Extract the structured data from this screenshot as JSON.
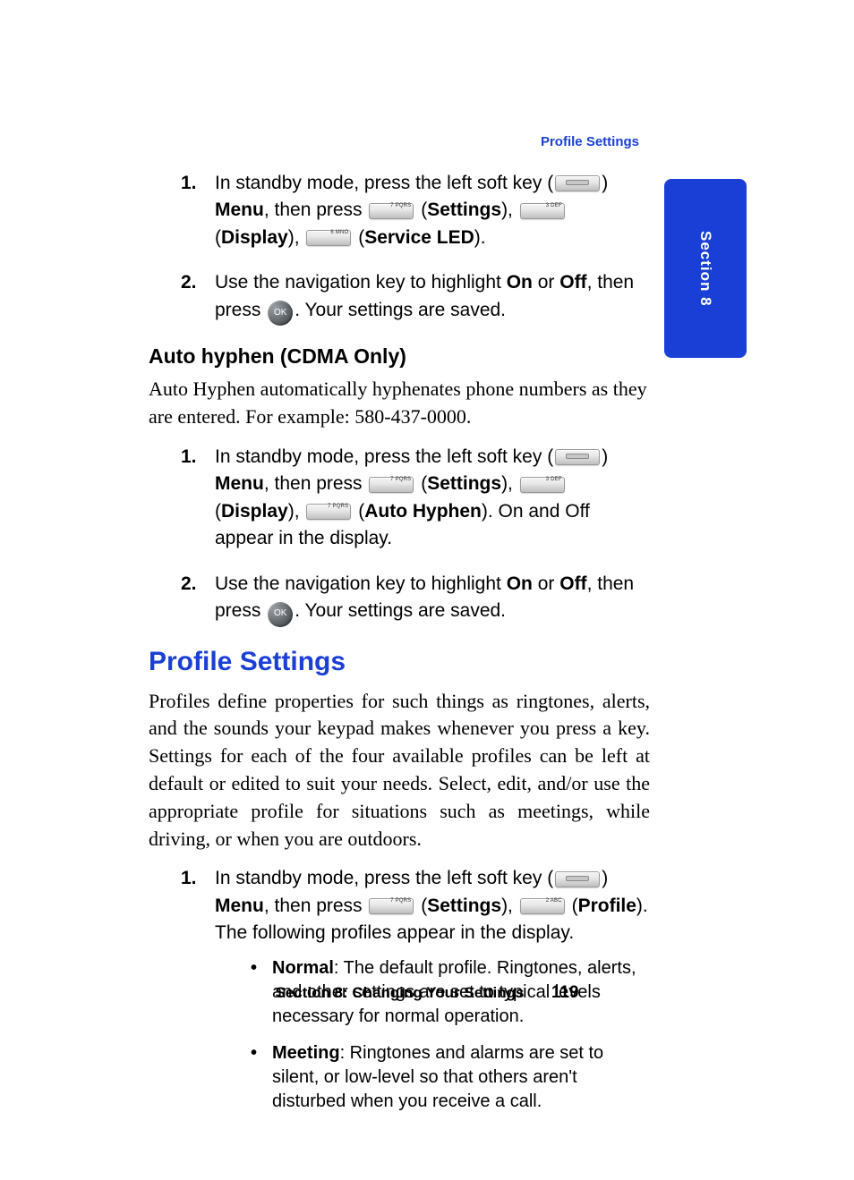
{
  "header": {
    "right": "Profile Settings"
  },
  "sideTab": {
    "label": "Section 8"
  },
  "keys": {
    "k7": "7 PQRS",
    "k3": "3 DEF",
    "k6": "6 MNO",
    "k2": "2 ABC",
    "ok": "OK"
  },
  "block1": {
    "step1": {
      "num": "1.",
      "t1": "In standby mode, press the left soft key (",
      "t2": ") ",
      "menu": "Menu",
      "t3": ", then press ",
      "t4": " (",
      "settings": "Settings",
      "t5": "), ",
      "t6": " (",
      "display": "Display",
      "t7": "), ",
      "t8": " (",
      "serviceLed": "Service LED",
      "t9": ")."
    },
    "step2": {
      "num": "2.",
      "t1": "Use the navigation key to highlight ",
      "on": "On",
      "t2": " or ",
      "off": "Off",
      "t3": ", then press ",
      "t4": ". Your settings are saved."
    }
  },
  "autoHyphen": {
    "heading": "Auto hyphen (CDMA Only)",
    "para": "Auto Hyphen automatically hyphenates phone numbers as they are entered. For example: 580-437-0000.",
    "step1": {
      "num": "1.",
      "t1": "In standby mode, press the left soft key (",
      "t2": ") ",
      "menu": "Menu",
      "t3": ", then press ",
      "t4": " (",
      "settings": "Settings",
      "t5": "), ",
      "t6": " (",
      "display": "Display",
      "t7": "), ",
      "t8": " (",
      "autoHyphen": "Auto Hyphen",
      "t9": "). On and Off appear in the display."
    },
    "step2": {
      "num": "2.",
      "t1": "Use the navigation key to highlight ",
      "on": "On",
      "t2": " or ",
      "off": "Off",
      "t3": ", then press ",
      "t4": ". Your settings are saved."
    }
  },
  "profile": {
    "heading": "Profile Settings",
    "para": "Profiles define properties for such things as ringtones, alerts, and the sounds your keypad makes whenever you press a key. Settings for each of the four available profiles can be left at default or edited to suit your needs. Select, edit, and/or use the appropriate profile for situations such as meetings, while driving, or when you are outdoors.",
    "step1": {
      "num": "1.",
      "t1": "In standby mode, press the left soft key (",
      "t2": ") ",
      "menu": "Menu",
      "t3": ", then press ",
      "t4": " (",
      "settings": "Settings",
      "t5": "), ",
      "t6": " (",
      "profileWord": "Profile",
      "t7": "). The following profiles  appear in the display."
    },
    "bullets": {
      "normal": {
        "title": "Normal",
        "text": ": The default profile. Ringtones, alerts, and other settings are set to typical levels necessary for normal operation."
      },
      "meeting": {
        "title": "Meeting",
        "text": ": Ringtones and alarms are set to silent, or low-level so that others aren't disturbed when you receive a call."
      }
    }
  },
  "footer": {
    "title": "Section 8: Changing Your Settings",
    "page": "119"
  }
}
